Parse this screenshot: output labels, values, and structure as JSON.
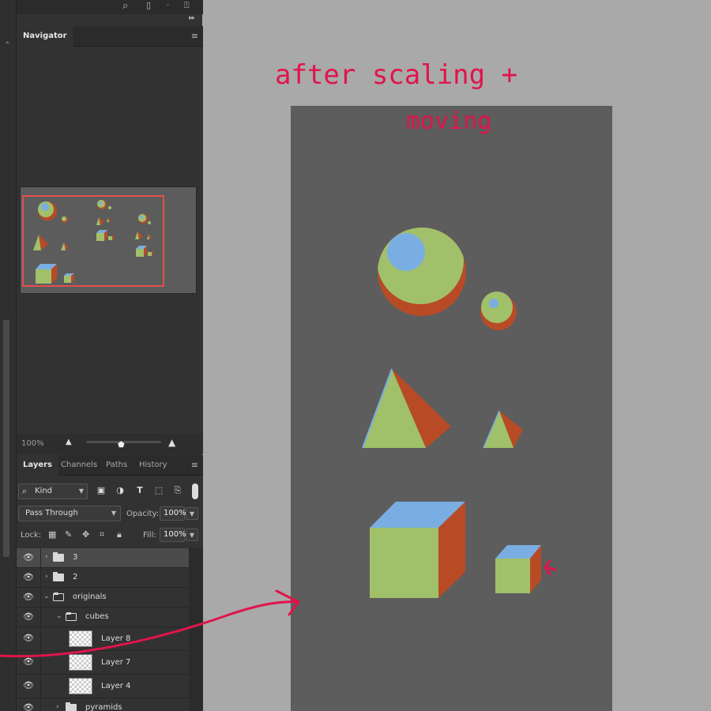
{
  "navigator": {
    "tab": "Navigator",
    "zoom": "100%"
  },
  "layers_panel": {
    "tabs": [
      "Layers",
      "Channels",
      "Paths",
      "History"
    ],
    "filter_kind": "Kind",
    "blend_mode": "Pass Through",
    "opacity_label": "Opacity:",
    "opacity_value": "100%",
    "lock_label": "Lock:",
    "fill_label": "Fill:",
    "fill_value": "100%",
    "layers": [
      {
        "name": "3",
        "type": "group",
        "expanded": false,
        "selected": true
      },
      {
        "name": "2",
        "type": "group",
        "expanded": false
      },
      {
        "name": "originals",
        "type": "group",
        "expanded": true
      },
      {
        "name": "cubes",
        "type": "group",
        "expanded": true
      },
      {
        "name": "Layer 8",
        "type": "layer"
      },
      {
        "name": "Layer 7",
        "type": "layer"
      },
      {
        "name": "Layer 4",
        "type": "layer"
      },
      {
        "name": "pyramids",
        "type": "group",
        "expanded": false
      }
    ]
  },
  "annotation": {
    "line1": "after  scaling +",
    "line2": "moving",
    "color": "#e0144b"
  },
  "shape_colors": {
    "green": "#a1c06a",
    "blue": "#7aaee2",
    "orange": "#b84b25",
    "canvas": "#5d5d5d"
  }
}
